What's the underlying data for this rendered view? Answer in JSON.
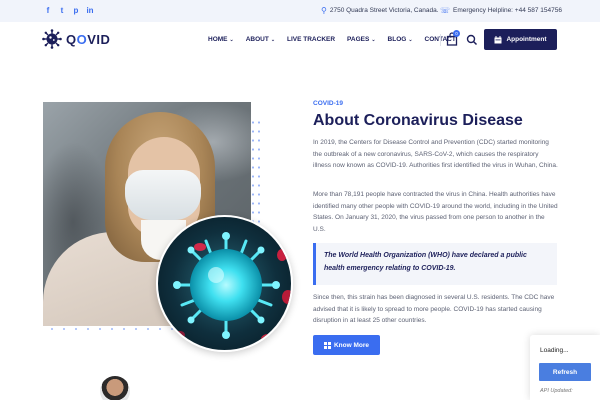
{
  "topbar": {
    "social": [
      "f",
      "t",
      "p",
      "in"
    ],
    "address": "2750 Quadra Street Victoria, Canada.",
    "helpline": "Emergency Helpline: +44 587 154756"
  },
  "header": {
    "logo": {
      "pre": "Q",
      "o": "O",
      "post": "VID"
    },
    "nav": [
      "HOME",
      "ABOUT",
      "LIVE TRACKER",
      "PAGES",
      "BLOG",
      "CONTACT"
    ],
    "cart_count": "0",
    "appointment_label": "Appointment"
  },
  "about": {
    "eyebrow": "COVID-19",
    "title": "About Coronavirus Disease",
    "p1": "In 2019, the Centers for Disease Control and Prevention (CDC) started monitoring the outbreak of a new coronavirus, SARS-CoV-2, which causes the respiratory illness now known as COVID-19. Authorities first identified the virus in Wuhan, China.",
    "p2": "More than 78,191 people have contracted the virus in China. Health authorities have identified many other people with COVID-19 around the world, including in the United States. On January 31, 2020, the virus passed from one person to another in the U.S.",
    "quote": "The World Health Organization (WHO) have declared a public health emergency relating to COVID-19.",
    "p3": "Since then, this strain has been diagnosed in several U.S. residents. The CDC have advised that it is likely to spread to more people. COVID-19 has started causing disruption in at least 25 other countries.",
    "button": "Know More"
  },
  "widget": {
    "loading": "Loading...",
    "refresh": "Refresh",
    "footer": "API Updated:"
  },
  "colors": {
    "accent": "#3a6df0",
    "navy": "#1c1f5a"
  }
}
